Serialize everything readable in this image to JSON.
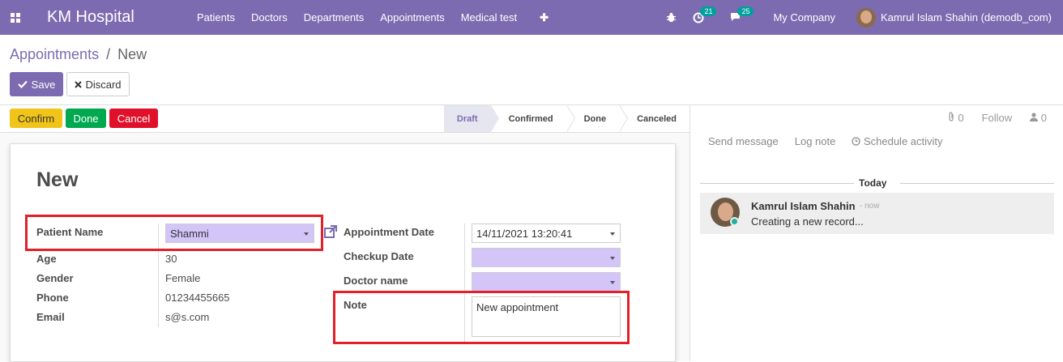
{
  "topbar": {
    "brand": "KM Hospital",
    "menu": [
      "Patients",
      "Doctors",
      "Departments",
      "Appointments",
      "Medical test"
    ],
    "plus": "✚",
    "activity_count": "21",
    "message_count": "25",
    "company": "My Company",
    "user": "Kamrul Islam Shahin (demodb_com)",
    "colors": {
      "bar": "#7c6bb0",
      "badge": "#00a09d"
    }
  },
  "breadcrumb": {
    "parent": "Appointments",
    "sep": "/",
    "current": "New"
  },
  "actions": {
    "save": "Save",
    "discard": "Discard"
  },
  "statusbar": {
    "confirm": "Confirm",
    "done": "Done",
    "cancel": "Cancel",
    "stages": [
      "Draft",
      "Confirmed",
      "Done",
      "Canceled"
    ],
    "active_stage": "Draft"
  },
  "form": {
    "title": "New",
    "patient_label": "Patient Name",
    "patient_value": "Shammi",
    "age_label": "Age",
    "age_value": "30",
    "gender_label": "Gender",
    "gender_value": "Female",
    "phone_label": "Phone",
    "phone_value": "01234455665",
    "email_label": "Email",
    "email_value": "s@s.com",
    "appointment_date_label": "Appointment Date",
    "appointment_date_value": "14/11/2021 13:20:41",
    "checkup_date_label": "Checkup Date",
    "checkup_date_value": "",
    "doctor_label": "Doctor name",
    "doctor_value": "",
    "note_label": "Note",
    "note_value": "New appointment"
  },
  "chatter": {
    "attachments": "0",
    "follow": "Follow",
    "followers": "0",
    "send_message": "Send message",
    "log_note": "Log note",
    "schedule_activity": "Schedule activity",
    "day": "Today",
    "message": {
      "author": "Kamrul Islam Shahin",
      "time": "- now",
      "body": "Creating a new record..."
    }
  }
}
